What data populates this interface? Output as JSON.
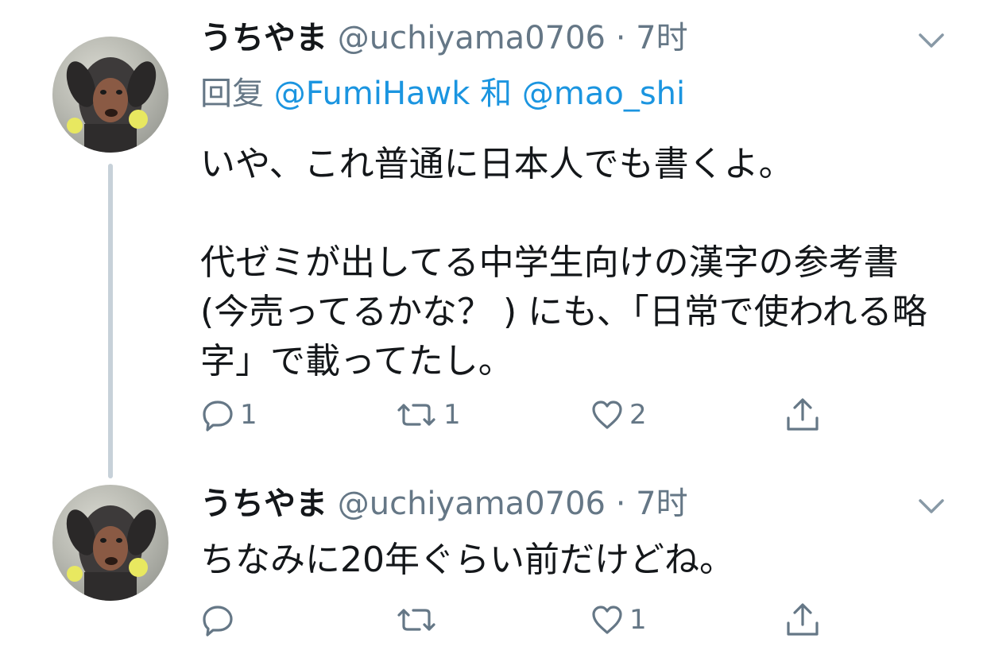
{
  "tweets": [
    {
      "display_name": "うちやま",
      "handle": "@uchiyama0706",
      "separator": "·",
      "time": "7时",
      "reply_prefix": "回复",
      "reply_mention_1": "@FumiHawk",
      "reply_join": "和",
      "reply_mention_2": "@mao_shi",
      "body": "いや、これ普通に日本人でも書くよ。\n\n代ゼミが出してる中学生向けの漢字の参考書 (今売ってるかな？ ) にも、「日常で使われる略字」で載ってたし。",
      "reply_count": "1",
      "retweet_count": "1",
      "like_count": "2"
    },
    {
      "display_name": "うちやま",
      "handle": "@uchiyama0706",
      "separator": "·",
      "time": "7时",
      "body": "ちなみに20年ぐらい前だけどね。",
      "reply_count": "",
      "retweet_count": "",
      "like_count": "1"
    }
  ],
  "colors": {
    "text": "#14171a",
    "secondary": "#657786",
    "link": "#1b95e0",
    "thread_line": "#c7d1d9"
  },
  "icons": {
    "reply": "reply-icon",
    "retweet": "retweet-icon",
    "like": "heart-icon",
    "share": "share-icon",
    "menu": "chevron-down-icon"
  }
}
